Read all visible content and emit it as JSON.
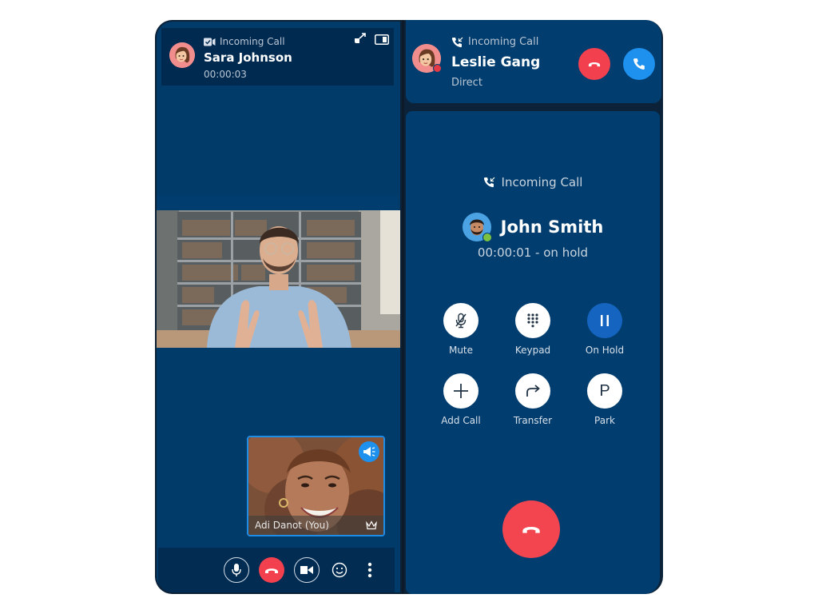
{
  "left_window": {
    "header": {
      "status_icon": "video-camera-icon",
      "status": "Incoming Call",
      "caller_name": "Sara Johnson",
      "timer": "00:00:03",
      "actions": [
        {
          "name": "popout-icon",
          "label": "Pop out"
        },
        {
          "name": "picture-in-picture-icon",
          "label": "Picture in picture"
        }
      ]
    },
    "main_video": {
      "description": "Remote participant video – man in blue shirt in front of bookshelf"
    },
    "self_video": {
      "participant_name": "Adi Danot (You)",
      "badge_icon": "megaphone-icon",
      "host_icon": "crown-icon"
    },
    "controls": [
      {
        "name": "microphone-button",
        "icon": "microphone-icon"
      },
      {
        "name": "hang-up-button",
        "icon": "phone-hangup-icon"
      },
      {
        "name": "camera-button",
        "icon": "video-camera-icon"
      },
      {
        "name": "reactions-button",
        "icon": "smiley-icon"
      },
      {
        "name": "more-options-button",
        "icon": "more-vertical-icon"
      }
    ]
  },
  "right_window": {
    "incoming": {
      "status_icon": "incoming-call-icon",
      "status": "Incoming Call",
      "caller_name": "Leslie Gang",
      "call_type": "Direct",
      "presence": "busy",
      "colors": {
        "decline": "#f3404f",
        "accept": "#1e90ee",
        "presence_busy": "#e53945"
      }
    },
    "active_call": {
      "status": "Incoming Call",
      "caller_name": "John Smith",
      "timer": "00:00:01 - on hold",
      "presence": "available",
      "colors": {
        "presence_available": "#7cc242",
        "hold_active": "#1565c0",
        "end_call": "#f3454f"
      },
      "actions": [
        {
          "label": "Mute",
          "icon": "microphone-muted-icon",
          "active": false
        },
        {
          "label": "Keypad",
          "icon": "keypad-icon",
          "active": false
        },
        {
          "label": "On Hold",
          "icon": "pause-icon",
          "active": true
        },
        {
          "label": "Add Call",
          "icon": "plus-icon",
          "active": false
        },
        {
          "label": "Transfer",
          "icon": "transfer-arrow-icon",
          "active": false
        },
        {
          "label": "Park",
          "icon": "park-icon",
          "active": false,
          "glyph": "P"
        }
      ]
    }
  }
}
